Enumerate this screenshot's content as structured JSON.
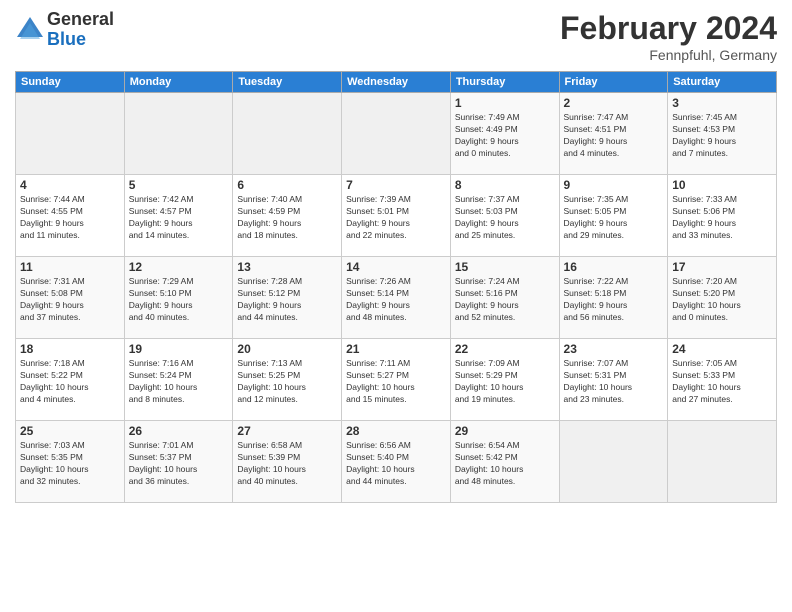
{
  "header": {
    "logo_general": "General",
    "logo_blue": "Blue",
    "month": "February 2024",
    "location": "Fennpfuhl, Germany"
  },
  "weekdays": [
    "Sunday",
    "Monday",
    "Tuesday",
    "Wednesday",
    "Thursday",
    "Friday",
    "Saturday"
  ],
  "weeks": [
    [
      {
        "day": "",
        "info": ""
      },
      {
        "day": "",
        "info": ""
      },
      {
        "day": "",
        "info": ""
      },
      {
        "day": "",
        "info": ""
      },
      {
        "day": "1",
        "info": "Sunrise: 7:49 AM\nSunset: 4:49 PM\nDaylight: 9 hours\nand 0 minutes."
      },
      {
        "day": "2",
        "info": "Sunrise: 7:47 AM\nSunset: 4:51 PM\nDaylight: 9 hours\nand 4 minutes."
      },
      {
        "day": "3",
        "info": "Sunrise: 7:45 AM\nSunset: 4:53 PM\nDaylight: 9 hours\nand 7 minutes."
      }
    ],
    [
      {
        "day": "4",
        "info": "Sunrise: 7:44 AM\nSunset: 4:55 PM\nDaylight: 9 hours\nand 11 minutes."
      },
      {
        "day": "5",
        "info": "Sunrise: 7:42 AM\nSunset: 4:57 PM\nDaylight: 9 hours\nand 14 minutes."
      },
      {
        "day": "6",
        "info": "Sunrise: 7:40 AM\nSunset: 4:59 PM\nDaylight: 9 hours\nand 18 minutes."
      },
      {
        "day": "7",
        "info": "Sunrise: 7:39 AM\nSunset: 5:01 PM\nDaylight: 9 hours\nand 22 minutes."
      },
      {
        "day": "8",
        "info": "Sunrise: 7:37 AM\nSunset: 5:03 PM\nDaylight: 9 hours\nand 25 minutes."
      },
      {
        "day": "9",
        "info": "Sunrise: 7:35 AM\nSunset: 5:05 PM\nDaylight: 9 hours\nand 29 minutes."
      },
      {
        "day": "10",
        "info": "Sunrise: 7:33 AM\nSunset: 5:06 PM\nDaylight: 9 hours\nand 33 minutes."
      }
    ],
    [
      {
        "day": "11",
        "info": "Sunrise: 7:31 AM\nSunset: 5:08 PM\nDaylight: 9 hours\nand 37 minutes."
      },
      {
        "day": "12",
        "info": "Sunrise: 7:29 AM\nSunset: 5:10 PM\nDaylight: 9 hours\nand 40 minutes."
      },
      {
        "day": "13",
        "info": "Sunrise: 7:28 AM\nSunset: 5:12 PM\nDaylight: 9 hours\nand 44 minutes."
      },
      {
        "day": "14",
        "info": "Sunrise: 7:26 AM\nSunset: 5:14 PM\nDaylight: 9 hours\nand 48 minutes."
      },
      {
        "day": "15",
        "info": "Sunrise: 7:24 AM\nSunset: 5:16 PM\nDaylight: 9 hours\nand 52 minutes."
      },
      {
        "day": "16",
        "info": "Sunrise: 7:22 AM\nSunset: 5:18 PM\nDaylight: 9 hours\nand 56 minutes."
      },
      {
        "day": "17",
        "info": "Sunrise: 7:20 AM\nSunset: 5:20 PM\nDaylight: 10 hours\nand 0 minutes."
      }
    ],
    [
      {
        "day": "18",
        "info": "Sunrise: 7:18 AM\nSunset: 5:22 PM\nDaylight: 10 hours\nand 4 minutes."
      },
      {
        "day": "19",
        "info": "Sunrise: 7:16 AM\nSunset: 5:24 PM\nDaylight: 10 hours\nand 8 minutes."
      },
      {
        "day": "20",
        "info": "Sunrise: 7:13 AM\nSunset: 5:25 PM\nDaylight: 10 hours\nand 12 minutes."
      },
      {
        "day": "21",
        "info": "Sunrise: 7:11 AM\nSunset: 5:27 PM\nDaylight: 10 hours\nand 15 minutes."
      },
      {
        "day": "22",
        "info": "Sunrise: 7:09 AM\nSunset: 5:29 PM\nDaylight: 10 hours\nand 19 minutes."
      },
      {
        "day": "23",
        "info": "Sunrise: 7:07 AM\nSunset: 5:31 PM\nDaylight: 10 hours\nand 23 minutes."
      },
      {
        "day": "24",
        "info": "Sunrise: 7:05 AM\nSunset: 5:33 PM\nDaylight: 10 hours\nand 27 minutes."
      }
    ],
    [
      {
        "day": "25",
        "info": "Sunrise: 7:03 AM\nSunset: 5:35 PM\nDaylight: 10 hours\nand 32 minutes."
      },
      {
        "day": "26",
        "info": "Sunrise: 7:01 AM\nSunset: 5:37 PM\nDaylight: 10 hours\nand 36 minutes."
      },
      {
        "day": "27",
        "info": "Sunrise: 6:58 AM\nSunset: 5:39 PM\nDaylight: 10 hours\nand 40 minutes."
      },
      {
        "day": "28",
        "info": "Sunrise: 6:56 AM\nSunset: 5:40 PM\nDaylight: 10 hours\nand 44 minutes."
      },
      {
        "day": "29",
        "info": "Sunrise: 6:54 AM\nSunset: 5:42 PM\nDaylight: 10 hours\nand 48 minutes."
      },
      {
        "day": "",
        "info": ""
      },
      {
        "day": "",
        "info": ""
      }
    ]
  ]
}
